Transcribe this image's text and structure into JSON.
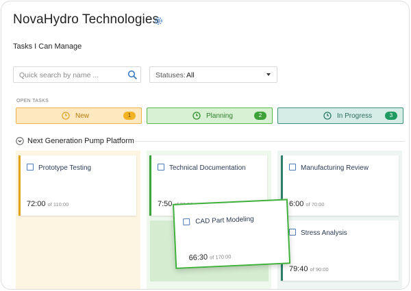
{
  "header": {
    "title": "NovaHydro Technologies",
    "subtitle": "Tasks I Can Manage"
  },
  "search": {
    "placeholder": "Quick search by name ..."
  },
  "status_filter": {
    "label": "Statuses:",
    "value": "All"
  },
  "open_tasks_label": "OPEN TASKS",
  "stages": [
    {
      "name": "New",
      "count": "1",
      "color": "#e9b24a"
    },
    {
      "name": "Planning",
      "count": "2",
      "color": "#56b84a"
    },
    {
      "name": "In Progress",
      "count": "3",
      "color": "#3d8f7c"
    }
  ],
  "project": {
    "name": "Next Generation Pump Platform"
  },
  "columns": {
    "new": [
      {
        "name": "Prototype Testing",
        "time": "72:00",
        "of": "of 110:00"
      }
    ],
    "planning": [
      {
        "name": "Technical Documentation",
        "time": "7:50",
        "of": "of 80:00"
      }
    ],
    "in_progress": [
      {
        "name": "Manufacturing Review",
        "time": "6:00",
        "of": "of 70:00"
      },
      {
        "name": "Stress Analysis",
        "time": "79:40",
        "of": "of 90:00"
      }
    ]
  },
  "dragging_card": {
    "name": "CAD Part Modeling",
    "time": "66:30",
    "of": "of 170:00"
  }
}
